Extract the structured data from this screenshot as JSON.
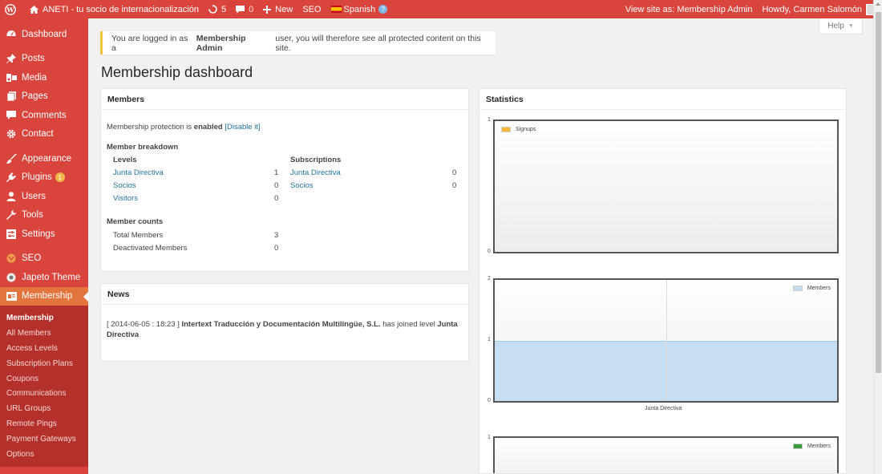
{
  "adminbar": {
    "site_name": "ANETI - tu socio de internacionalización",
    "updates_count": "5",
    "comments_count": "0",
    "new_label": "New",
    "seo_label": "SEO",
    "language": "Spanish",
    "view_site_as": "View site as: Membership Admin",
    "howdy": "Howdy, Carmen Salomón"
  },
  "help_label": "Help",
  "sidebar": {
    "items": [
      {
        "label": "Dashboard",
        "icon": "dashboard-icon"
      },
      {
        "label": "Posts",
        "icon": "pin-icon"
      },
      {
        "label": "Media",
        "icon": "media-icon"
      },
      {
        "label": "Pages",
        "icon": "page-icon"
      },
      {
        "label": "Comments",
        "icon": "comment-icon"
      },
      {
        "label": "Contact",
        "icon": "gear-icon"
      },
      {
        "label": "Appearance",
        "icon": "brush-icon"
      },
      {
        "label": "Plugins",
        "icon": "plug-icon",
        "badge": "1"
      },
      {
        "label": "Users",
        "icon": "user-icon"
      },
      {
        "label": "Tools",
        "icon": "wrench-icon"
      },
      {
        "label": "Settings",
        "icon": "settings-icon"
      },
      {
        "label": "SEO",
        "icon": "seo-icon"
      },
      {
        "label": "Japeto Theme",
        "icon": "theme-icon"
      },
      {
        "label": "Membership",
        "icon": "membership-icon"
      }
    ],
    "submenu": [
      "Membership",
      "All Members",
      "Access Levels",
      "Subscription Plans",
      "Coupons",
      "Communications",
      "URL Groups",
      "Remote Pings",
      "Payment Gateways",
      "Options"
    ]
  },
  "notice": {
    "prefix": "You are logged in as a",
    "role": "Membership Admin",
    "suffix": "user, you will therefore see all protected content on this site."
  },
  "page_title": "Membership dashboard",
  "members": {
    "header": "Members",
    "protection_prefix": "Membership protection is",
    "protection_state": "enabled",
    "disable_link": "[Disable it]",
    "breakdown_label": "Member breakdown",
    "levels_label": "Levels",
    "subscriptions_label": "Subscriptions",
    "levels": [
      {
        "name": "Junta Directiva",
        "count": "1"
      },
      {
        "name": "Socios",
        "count": "0"
      },
      {
        "name": "Visitors",
        "count": "0"
      }
    ],
    "subscriptions": [
      {
        "name": "Junta Directiva",
        "count": "0"
      },
      {
        "name": "Socios",
        "count": "0"
      }
    ],
    "counts_label": "Member counts",
    "total_label": "Total Members",
    "total_value": "3",
    "deactivated_label": "Deactivated Members",
    "deactivated_value": "0"
  },
  "news": {
    "header": "News",
    "date": "[ 2014-06-05 : 18:23 ]",
    "org": "Intertext Traducción y Documentación Multilingüe, S.L.",
    "middle": "has joined level",
    "level": "Junta Directiva"
  },
  "statistics": {
    "header": "Statistics"
  },
  "chart_data": [
    {
      "type": "bar",
      "series": [
        {
          "name": "Signups",
          "values": []
        }
      ],
      "yticks": [
        "1",
        "0"
      ],
      "ylim": [
        0,
        1
      ],
      "legend": "top-left",
      "color": "#f7b93a"
    },
    {
      "type": "bar",
      "categories": [
        "Junta Directiva"
      ],
      "series": [
        {
          "name": "Members",
          "values": [
            1
          ]
        }
      ],
      "yticks": [
        "2",
        "1",
        "0"
      ],
      "ylim": [
        0,
        2
      ],
      "legend": "top-right",
      "color": "#c3dcf0"
    },
    {
      "type": "bar",
      "series": [
        {
          "name": "Members",
          "values": []
        }
      ],
      "yticks": [
        "1"
      ],
      "legend": "top-right",
      "color": "#3a9a3a"
    }
  ]
}
